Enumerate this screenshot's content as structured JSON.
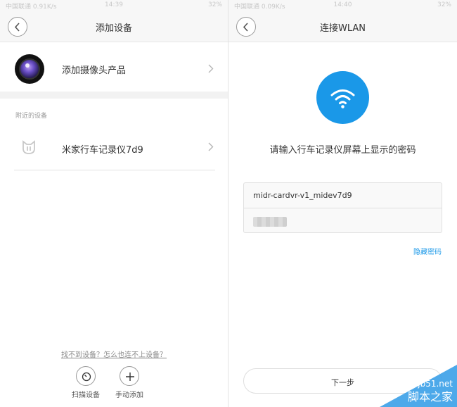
{
  "left_screen": {
    "status": {
      "left": "中国联通 0.91K/s",
      "time": "14:39",
      "right": "32%"
    },
    "nav": {
      "title": "添加设备"
    },
    "product": {
      "label": "添加摄像头产品"
    },
    "nearby": {
      "section_label": "附近的设备",
      "devices": [
        {
          "label": "米家行车记录仪7d9",
          "icon": "mijia-icon"
        }
      ]
    },
    "footer": {
      "help_link": "找不到设备？怎么也连不上设备？",
      "scan_label": "扫描设备",
      "manual_label": "手动添加"
    }
  },
  "right_screen": {
    "status": {
      "left": "中国联通 0.09K/s",
      "time": "14:40",
      "right": "32%"
    },
    "nav": {
      "title": "连接WLAN"
    },
    "prompt": "请输入行车记录仪屏幕上显示的密码",
    "ssid": "midr-cardvr-v1_midev7d9",
    "hide_password": "隐藏密码",
    "next_button": "下一步"
  },
  "watermark": {
    "site": "jb51.net",
    "name": "脚本之家"
  },
  "colors": {
    "accent": "#1a98e8",
    "divider": "#e2e2e2",
    "section_bg": "#f2f2f2"
  }
}
